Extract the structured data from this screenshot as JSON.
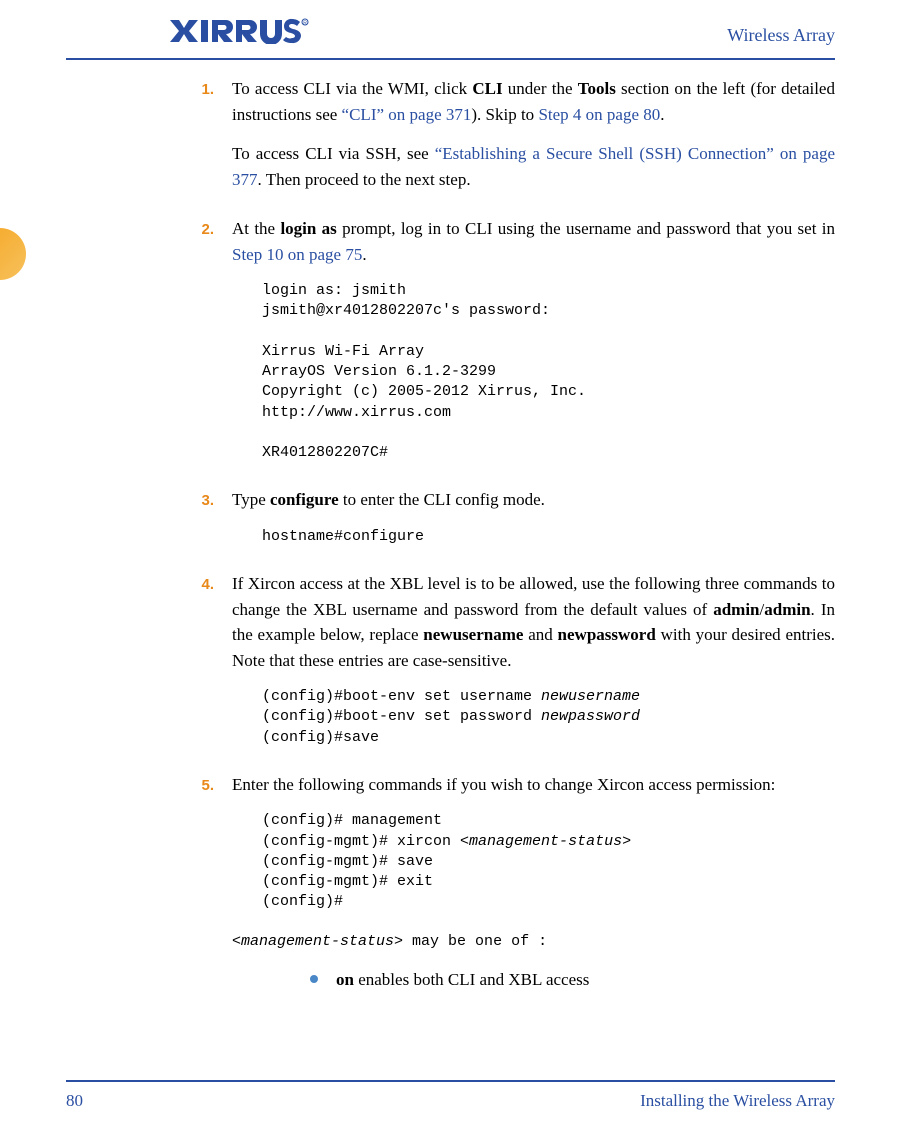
{
  "header": {
    "title": "Wireless Array",
    "logo_alt": "Xirrus"
  },
  "steps": {
    "s1": {
      "num": "1.",
      "p1_a": "To access CLI via the WMI, click ",
      "p1_b": "CLI",
      "p1_c": " under the ",
      "p1_d": "Tools",
      "p1_e": " section on the left (for detailed instructions see ",
      "p1_link1": "“CLI” on page 371",
      "p1_f": "). Skip to ",
      "p1_link2": "Step 4 on page 80",
      "p1_g": ".",
      "p2_a": "To access CLI via SSH, see ",
      "p2_link": "“Establishing a Secure Shell (SSH) Connection” on page 377",
      "p2_b": ". Then proceed to the next step."
    },
    "s2": {
      "num": "2.",
      "p1_a": "At the ",
      "p1_b": "login as",
      "p1_c": " prompt, log in to CLI using the username and password that you set in ",
      "p1_link": "Step 10 on page 75",
      "p1_d": ".",
      "code": "login as: jsmith\njsmith@xr4012802207c's password:\n\nXirrus Wi-Fi Array\nArrayOS Version 6.1.2-3299\nCopyright (c) 2005-2012 Xirrus, Inc.\nhttp://www.xirrus.com\n\nXR4012802207C#"
    },
    "s3": {
      "num": "3.",
      "p1_a": "Type ",
      "p1_b": "configure",
      "p1_c": " to enter the CLI config mode.",
      "code": "hostname#configure"
    },
    "s4": {
      "num": "4.",
      "p1_a": "If Xircon access at the XBL level is to be allowed, use the following three commands to change the XBL username and password from the default values of ",
      "p1_b": "admin",
      "p1_c": "/",
      "p1_d": "admin",
      "p1_e": ". In the example below, replace ",
      "p1_f": "newusername",
      "p1_g": " and ",
      "p1_h": "newpassword",
      "p1_i": " with your desired entries. Note that these entries are case-sensitive.",
      "code_pre1": "(config)#boot-env set username ",
      "code_i1": "newusername",
      "code_pre2": "(config)#boot-env set password ",
      "code_i2": "newpassword",
      "code_post": "(config)#save"
    },
    "s5": {
      "num": "5.",
      "p1": "Enter the following commands if you wish to change Xircon access permission:",
      "code_l1": "(config)# management",
      "code_l2a": "(config-mgmt)# xircon <",
      "code_l2b": "management-status",
      "code_l2c": ">",
      "code_l3": "(config-mgmt)# save",
      "code_l4": "(config-mgmt)# exit",
      "code_l5": "(config)#",
      "p2_a": "<",
      "p2_b": "management-status",
      "p2_c": "> may be one of :",
      "bullet_a": "on",
      "bullet_b": " enables both CLI and XBL access"
    }
  },
  "footer": {
    "page": "80",
    "section": "Installing the Wireless Array"
  }
}
